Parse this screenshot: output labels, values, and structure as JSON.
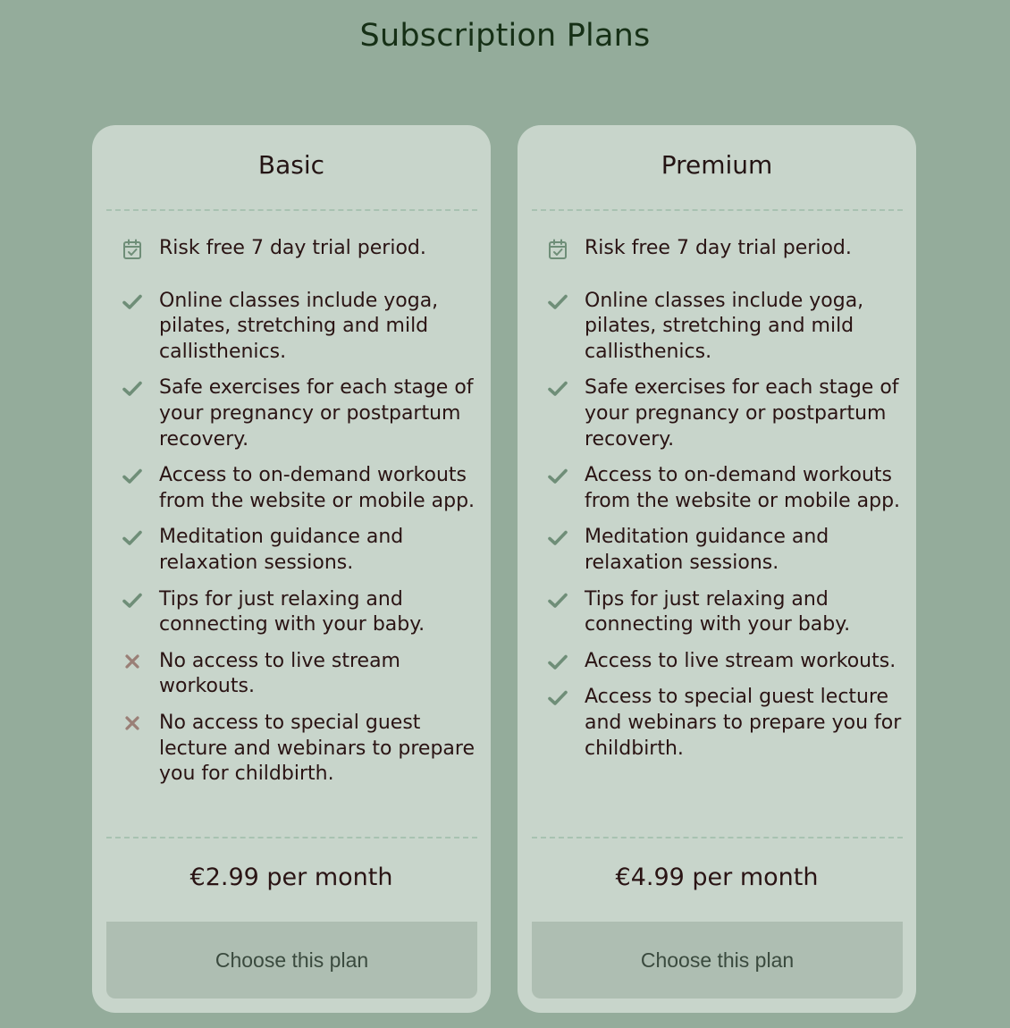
{
  "page": {
    "title": "Subscription Plans"
  },
  "colors": {
    "background": "#94ac9b",
    "card": "#c8d5cb",
    "button": "#aebeb2",
    "check": "#6f8e78",
    "cross": "#9a7f76",
    "title": "#163016",
    "text": "#2a1414"
  },
  "plans": [
    {
      "name": "Basic",
      "features": [
        {
          "icon": "calendar-check-icon",
          "text": "Risk free 7 day trial period."
        },
        {
          "icon": "check-icon",
          "text": "Online classes include yoga, pilates, stretching and mild callisthenics."
        },
        {
          "icon": "check-icon",
          "text": "Safe exercises for each stage of your pregnancy or postpartum recovery."
        },
        {
          "icon": "check-icon",
          "text": "Access to on-demand workouts from the website or mobile app."
        },
        {
          "icon": "check-icon",
          "text": "Meditation guidance and relaxation sessions."
        },
        {
          "icon": "check-icon",
          "text": "Tips for just relaxing and connecting with your baby."
        },
        {
          "icon": "cross-icon",
          "text": "No access to live stream workouts."
        },
        {
          "icon": "cross-icon",
          "text": "No access to special guest lecture and webinars to prepare you for childbirth."
        }
      ],
      "price": "€2.99 per month",
      "button_label": "Choose this plan"
    },
    {
      "name": "Premium",
      "features": [
        {
          "icon": "calendar-check-icon",
          "text": "Risk free 7 day trial period."
        },
        {
          "icon": "check-icon",
          "text": "Online classes include yoga, pilates, stretching and mild callisthenics."
        },
        {
          "icon": "check-icon",
          "text": "Safe exercises for each stage of your pregnancy or postpartum recovery."
        },
        {
          "icon": "check-icon",
          "text": "Access to on-demand workouts from the website or mobile app."
        },
        {
          "icon": "check-icon",
          "text": "Meditation guidance and relaxation sessions."
        },
        {
          "icon": "check-icon",
          "text": "Tips for just relaxing and connecting with your baby."
        },
        {
          "icon": "check-icon",
          "text": "Access to live stream workouts."
        },
        {
          "icon": "check-icon",
          "text": "Access to special guest lecture and webinars to prepare you for childbirth."
        }
      ],
      "price": "€4.99 per month",
      "button_label": "Choose this plan"
    }
  ]
}
